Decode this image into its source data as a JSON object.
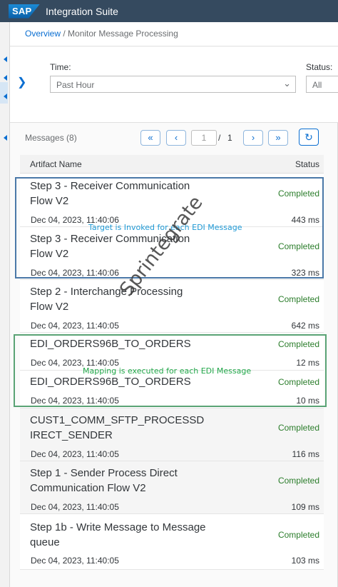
{
  "shell": {
    "logo_text": "SAP",
    "title": "Integration Suite",
    "bg_color": "#354a5f"
  },
  "breadcrumb": {
    "link": "Overview",
    "separator": " / ",
    "current": "Monitor Message Processing"
  },
  "filters": {
    "time": {
      "label": "Time:",
      "value": "Past Hour"
    },
    "status": {
      "label": "Status:",
      "value": "All"
    }
  },
  "table": {
    "count_label": "Messages (8)",
    "pagination": {
      "current_page_placeholder": "1",
      "separator": "/",
      "total_pages": "1"
    },
    "columns": {
      "name": "Artifact Name",
      "status": "Status"
    },
    "status_color": "#2b7d2b",
    "rows": [
      {
        "name": "Step 3 - Receiver Communication Flow V2",
        "date": "Dec 04, 2023, 11:40:06",
        "status": "Completed",
        "duration": "443 ms"
      },
      {
        "name": "Step 3 - Receiver Communication Flow V2",
        "date": "Dec 04, 2023, 11:40:06",
        "status": "Completed",
        "duration": "323 ms"
      },
      {
        "name": "Step 2 - Interchange Processing Flow V2",
        "date": "Dec 04, 2023, 11:40:05",
        "status": "Completed",
        "duration": "642 ms"
      },
      {
        "name": "EDI_ORDERS96B_TO_ORDERS",
        "date": "Dec 04, 2023, 11:40:05",
        "status": "Completed",
        "duration": "12 ms"
      },
      {
        "name": "EDI_ORDERS96B_TO_ORDERS",
        "date": "Dec 04, 2023, 11:40:05",
        "status": "Completed",
        "duration": "10 ms"
      },
      {
        "name": "CUST1_COMM_SFTP_PROCESSD IRECT_SENDER",
        "date": "Dec 04, 2023, 11:40:05",
        "status": "Completed",
        "duration": "116 ms"
      },
      {
        "name": "Step 1 - Sender Process Direct Communication Flow V2",
        "date": "Dec 04, 2023, 11:40:05",
        "status": "Completed",
        "duration": "109 ms"
      },
      {
        "name": "Step 1b - Write Message to Message queue",
        "date": "Dec 04, 2023, 11:40:05",
        "status": "Completed",
        "duration": "103 ms"
      }
    ]
  },
  "annotations": {
    "receiver_note": {
      "text": "Target is Invoked for each EDI Message",
      "color": "#1f9ad6",
      "box_color": "#4a78a8"
    },
    "mapping_note": {
      "text": "Mapping is executed for each EDI Message",
      "color": "#22a84a",
      "box_color": "#5aa375"
    },
    "watermark": "Sprintegrate"
  },
  "icons": {
    "expand": "chevron-right-icon",
    "dropdown": "chevron-down-icon",
    "first_page": "double-chevron-left-icon",
    "prev_page": "chevron-left-icon",
    "next_page": "chevron-right-icon",
    "last_page": "double-chevron-right-icon",
    "refresh": "refresh-icon"
  }
}
